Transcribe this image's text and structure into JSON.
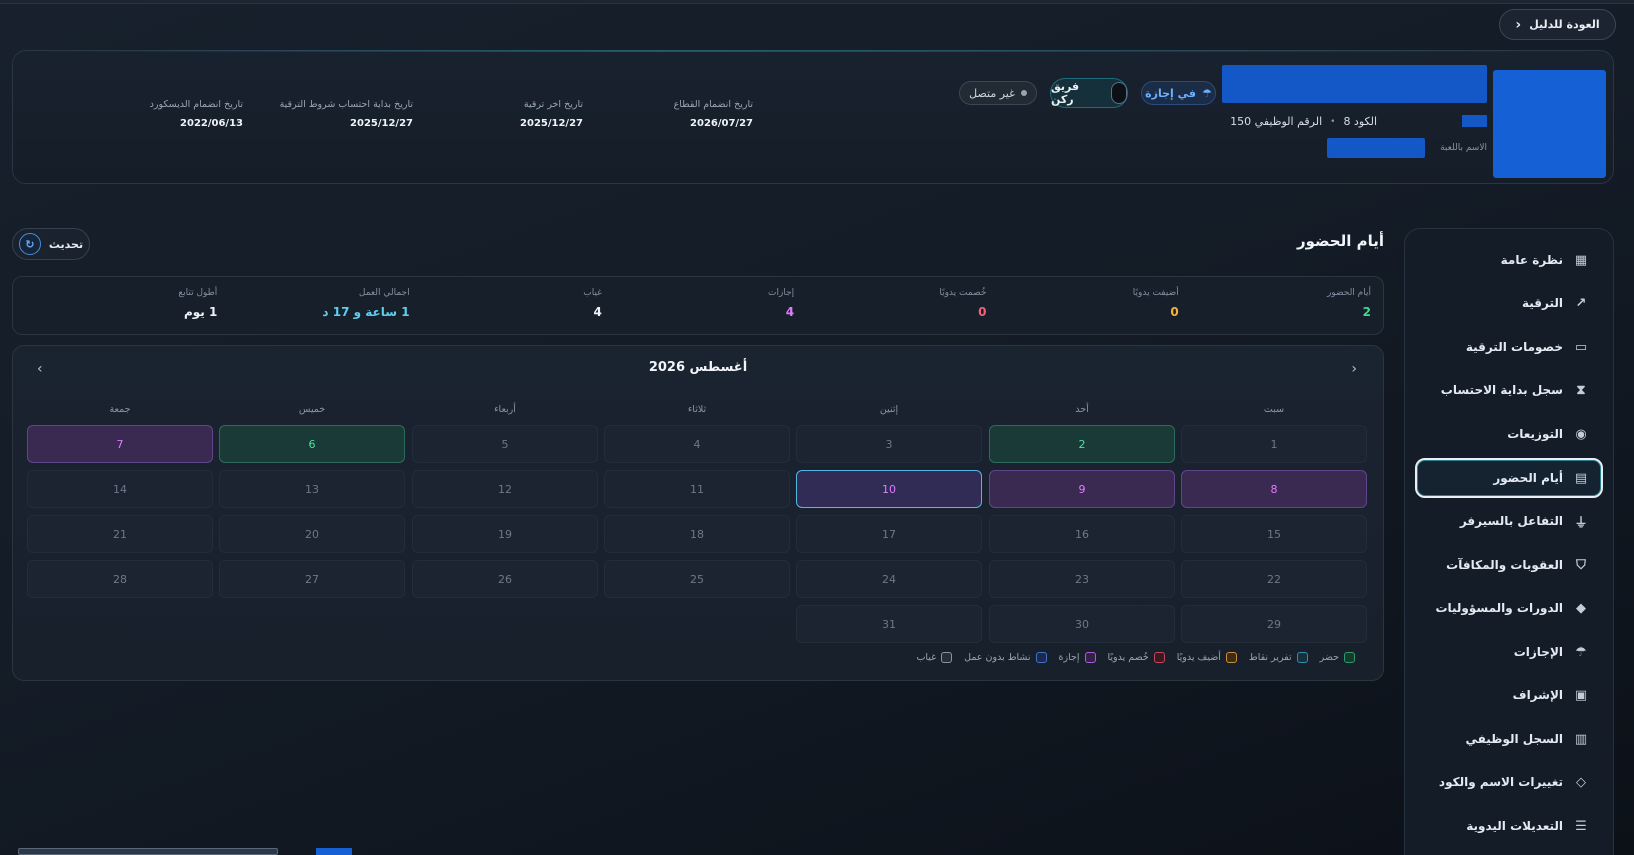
{
  "header": {
    "back_label": "العودة للدليل"
  },
  "profile": {
    "code_label": "الكود 8",
    "job_number_label": "الرقم الوظيفي 150",
    "nick_label": "الاسم باللعبة",
    "badges": {
      "leave": "في إجازة",
      "team": "فريق ركن",
      "status": "غير متصل"
    },
    "dates": [
      {
        "label": "تاريخ انضمام القطاع",
        "value": "2026/07/27"
      },
      {
        "label": "تاريخ اخر ترقية",
        "value": "2025/12/27"
      },
      {
        "label": "تاريخ بداية احتساب شروط الترقية",
        "value": "2025/12/27"
      },
      {
        "label": "تاريخ انضمام الديسكورد",
        "value": "2022/06/13"
      }
    ]
  },
  "sidebar": {
    "items": [
      {
        "label": "نظرة عامة",
        "icon": "grid-icon"
      },
      {
        "label": "الترقية",
        "icon": "trend-up-icon"
      },
      {
        "label": "خصومات الترقية",
        "icon": "ticket-icon"
      },
      {
        "label": "سجل بداية الاحتساب",
        "icon": "hourglass-icon"
      },
      {
        "label": "التوزيعات",
        "icon": "map-pin-icon"
      },
      {
        "label": "أيام الحضور",
        "icon": "calendar-icon",
        "active": true
      },
      {
        "label": "التفاعل بالسيرفر",
        "icon": "plug-icon"
      },
      {
        "label": "العقوبات والمكافآت",
        "icon": "shield-icon"
      },
      {
        "label": "الدورات والمسؤوليات",
        "icon": "graduation-cap-icon"
      },
      {
        "label": "الإجازات",
        "icon": "umbrella-icon"
      },
      {
        "label": "الإشراف",
        "icon": "clipboard-check-icon"
      },
      {
        "label": "السجل الوظيفي",
        "icon": "briefcase-icon"
      },
      {
        "label": "تغييرات الاسم والكود",
        "icon": "tag-icon"
      },
      {
        "label": "التعديلات اليدوية",
        "icon": "sliders-icon"
      }
    ]
  },
  "attendance": {
    "title": "أيام الحضور",
    "refresh_label": "تحديث",
    "stats": [
      {
        "label": "أيام الحضور",
        "value": "2",
        "color": "#3fd98f"
      },
      {
        "label": "أضيفت يدويًا",
        "value": "0",
        "color": "#f2b63c"
      },
      {
        "label": "خُصمت يدويًا",
        "value": "0",
        "color": "#f0647a"
      },
      {
        "label": "إجازات",
        "value": "4",
        "color": "#e07bff"
      },
      {
        "label": "غياب",
        "value": "4",
        "color": "#eef2f6"
      },
      {
        "label": "اجمالي العمل",
        "value": "1 ساعة و 17 د",
        "color": "#5ccff0"
      },
      {
        "label": "أطول تتابع",
        "value": "1 يوم",
        "color": "#eef2f6"
      }
    ]
  },
  "calendar": {
    "month": "أغسطس 2026",
    "weekdays": [
      "سبت",
      "أحد",
      "إثنين",
      "ثلاثاء",
      "أربعاء",
      "خميس",
      "جمعة"
    ],
    "days": [
      "1",
      "2",
      "3",
      "4",
      "5",
      "6",
      "7",
      "8",
      "9",
      "10",
      "11",
      "12",
      "13",
      "14",
      "15",
      "16",
      "17",
      "18",
      "19",
      "20",
      "21",
      "22",
      "23",
      "24",
      "25",
      "26",
      "27",
      "28",
      "29",
      "30",
      "31"
    ],
    "legend": [
      "حضر",
      "تفرير نقاط",
      "أضيف يدويًا",
      "خُصم يدويًا",
      "إجازة",
      "نشاط بدون عمل",
      "غياب"
    ],
    "legend_colors": [
      "#2f9a6a",
      "#2f8fb0",
      "#c9903a",
      "#c0465a",
      "#b05ad8",
      "#4470c8",
      "#8a94a2"
    ]
  }
}
